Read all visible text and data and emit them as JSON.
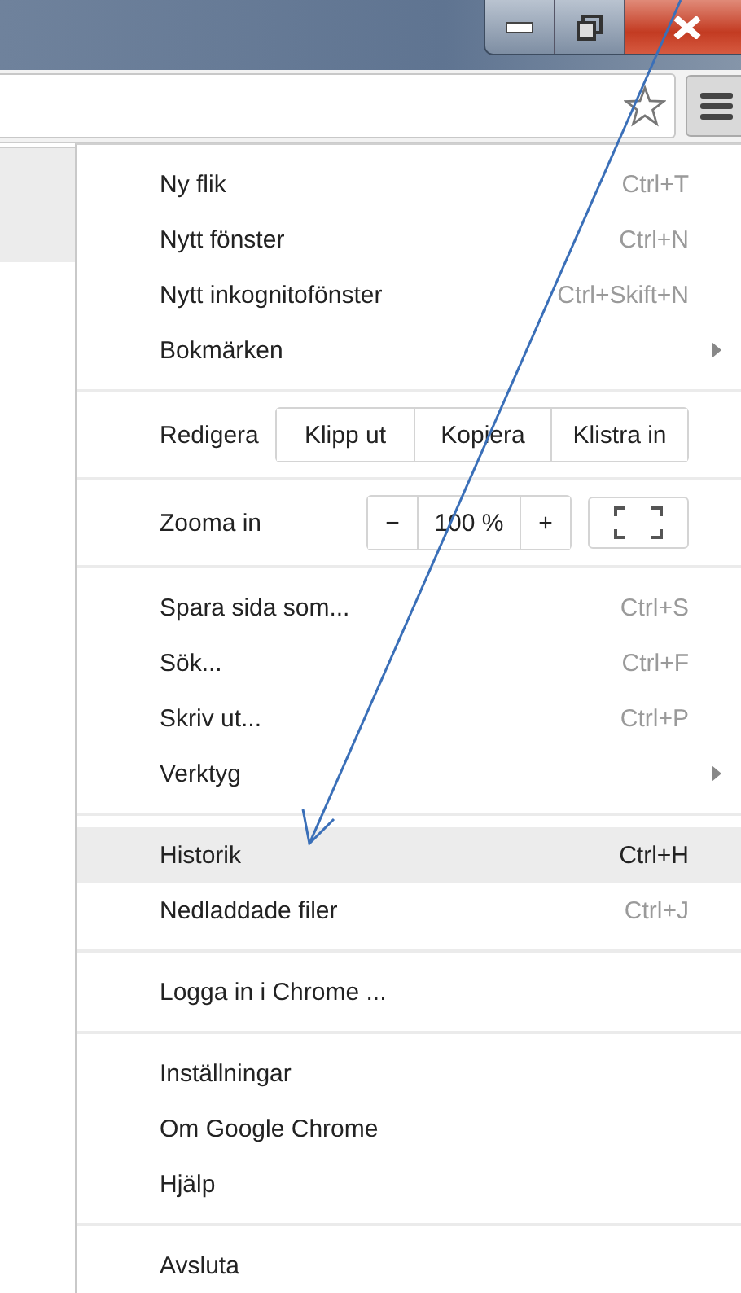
{
  "menu": {
    "sections": [
      [
        {
          "kind": "item",
          "label": "Ny flik",
          "shortcut": "Ctrl+T",
          "submenu": false,
          "selected": false
        },
        {
          "kind": "item",
          "label": "Nytt fönster",
          "shortcut": "Ctrl+N",
          "submenu": false,
          "selected": false
        },
        {
          "kind": "item",
          "label": "Nytt inkognitofönster",
          "shortcut": "Ctrl+Skift+N",
          "submenu": false,
          "selected": false
        },
        {
          "kind": "item",
          "label": "Bokmärken",
          "submenu": true,
          "selected": false
        }
      ],
      [
        {
          "kind": "edit",
          "label": "Redigera",
          "buttons": [
            "Klipp ut",
            "Kopiera",
            "Klistra in"
          ]
        }
      ],
      [
        {
          "kind": "zoom",
          "label": "Zooma in",
          "minus": "−",
          "value": "100 %",
          "plus": "+"
        }
      ],
      [
        {
          "kind": "item",
          "label": "Spara sida som...",
          "shortcut": "Ctrl+S",
          "submenu": false,
          "selected": false
        },
        {
          "kind": "item",
          "label": "Sök...",
          "shortcut": "Ctrl+F",
          "submenu": false,
          "selected": false
        },
        {
          "kind": "item",
          "label": "Skriv ut...",
          "shortcut": "Ctrl+P",
          "submenu": false,
          "selected": false
        },
        {
          "kind": "item",
          "label": "Verktyg",
          "submenu": true,
          "selected": false
        }
      ],
      [
        {
          "kind": "item",
          "label": "Historik",
          "shortcut": "Ctrl+H",
          "submenu": false,
          "selected": true
        },
        {
          "kind": "item",
          "label": "Nedladdade filer",
          "shortcut": "Ctrl+J",
          "submenu": false,
          "selected": false
        }
      ],
      [
        {
          "kind": "item",
          "label": "Logga in i Chrome ...",
          "submenu": false,
          "selected": false
        }
      ],
      [
        {
          "kind": "item",
          "label": "Inställningar",
          "submenu": false,
          "selected": false
        },
        {
          "kind": "item",
          "label": "Om Google Chrome",
          "submenu": false,
          "selected": false
        },
        {
          "kind": "item",
          "label": "Hjälp",
          "submenu": false,
          "selected": false
        }
      ],
      [
        {
          "kind": "item",
          "label": "Avsluta",
          "submenu": false,
          "selected": false
        }
      ]
    ]
  }
}
